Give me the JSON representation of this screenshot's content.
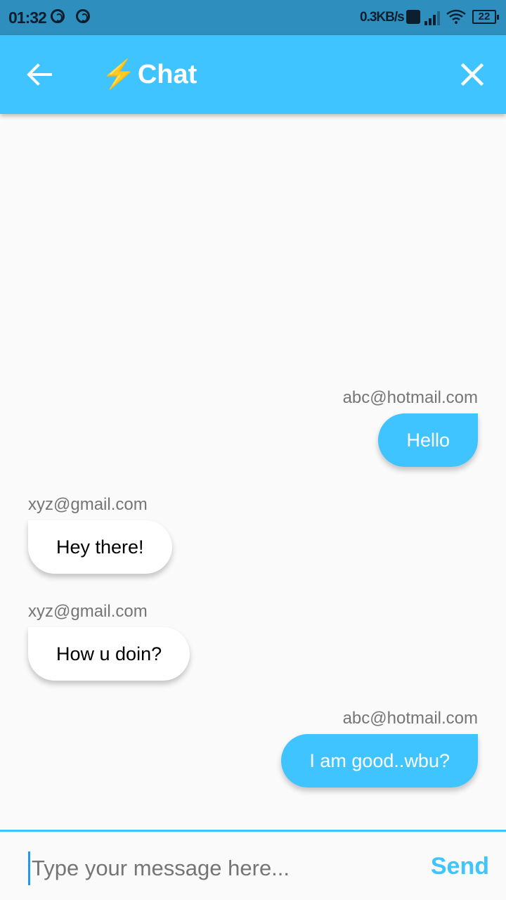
{
  "status_bar": {
    "time": "01:32",
    "net_speed": "0.3KB/s",
    "battery": "22"
  },
  "app_bar": {
    "title": "Chat",
    "title_icon": "⚡",
    "back_icon": "arrow-back-icon",
    "close_icon": "close-icon",
    "color": "#40c4ff"
  },
  "messages": [
    {
      "sender": "abc@hotmail.com",
      "text": "Hello",
      "is_me": true
    },
    {
      "sender": "xyz@gmail.com",
      "text": "Hey there!",
      "is_me": false
    },
    {
      "sender": "xyz@gmail.com",
      "text": "How u doin?",
      "is_me": false
    },
    {
      "sender": "abc@hotmail.com",
      "text": "I am good..wbu?",
      "is_me": true
    }
  ],
  "composer": {
    "placeholder": "Type your message here...",
    "value": "",
    "send_label": "Send"
  },
  "colors": {
    "accent": "#40c4ff",
    "status_bar": "#2e8fbf",
    "background": "#fafafa"
  }
}
